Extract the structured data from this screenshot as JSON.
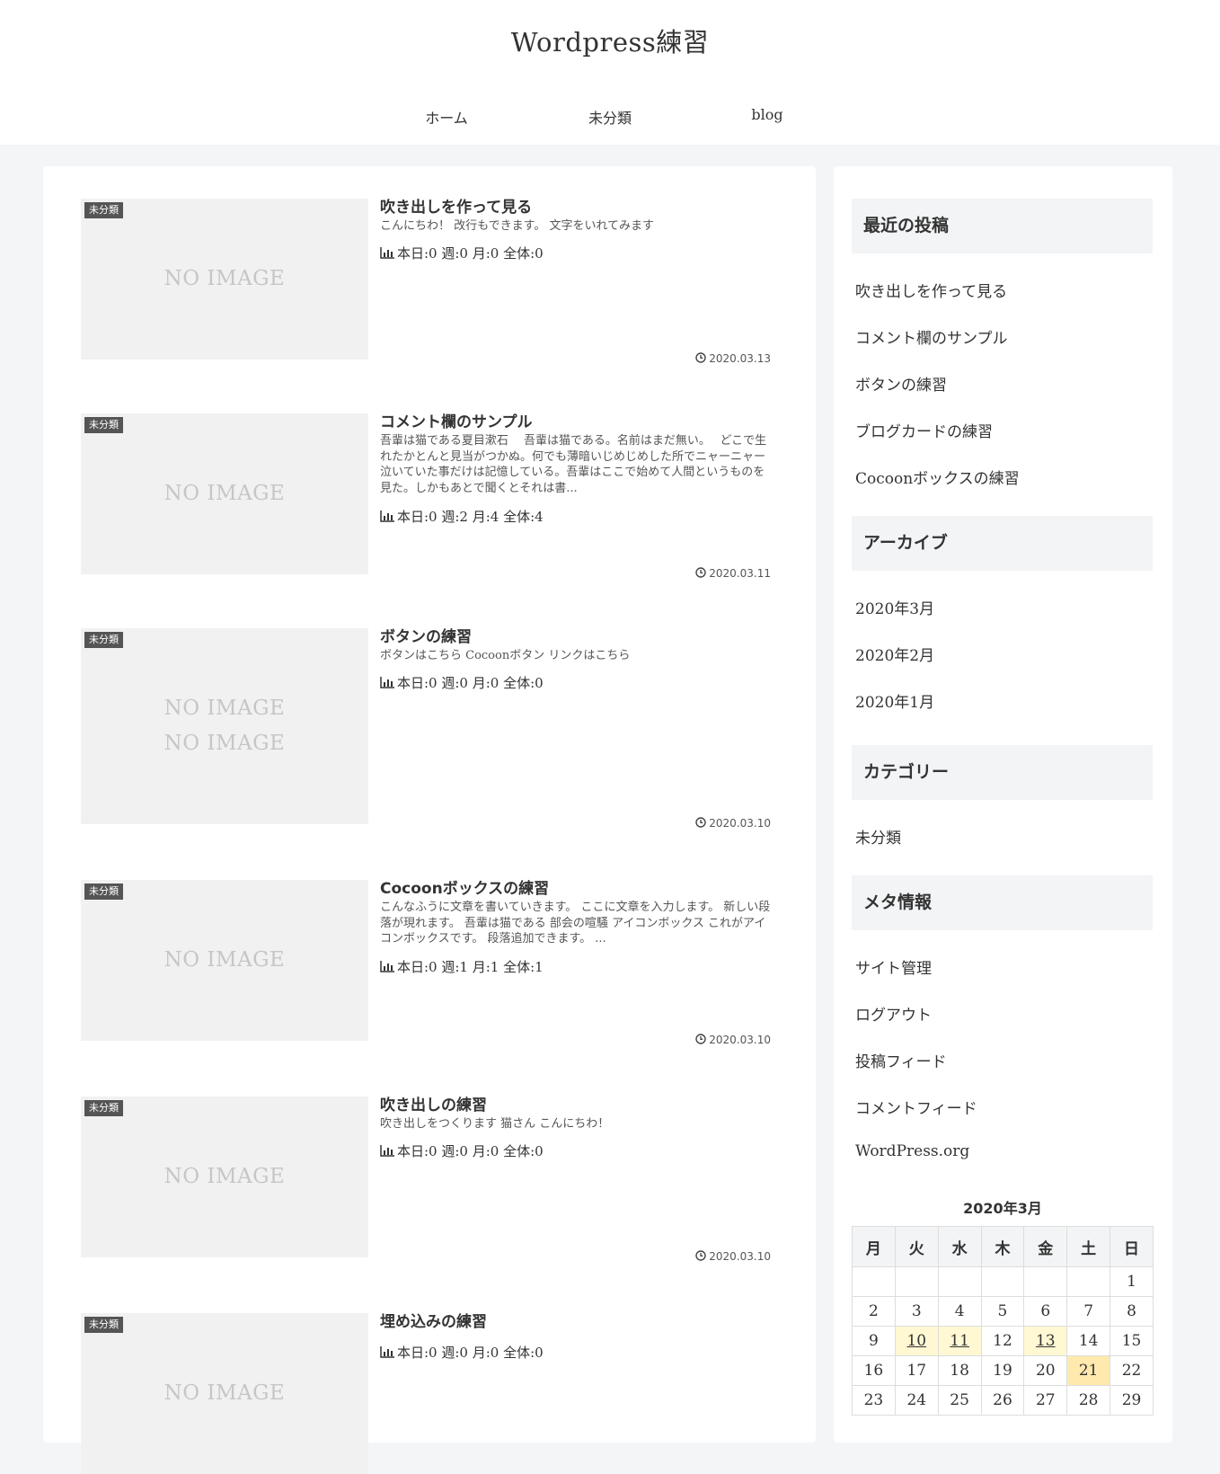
{
  "site": {
    "title": "Wordpress練習"
  },
  "nav": {
    "items": [
      "ホーム",
      "未分類",
      "blog"
    ]
  },
  "posts": [
    {
      "category": "未分類",
      "thumb_text": [
        "NO IMAGE"
      ],
      "title": "吹き出しを作って見る",
      "snippet": "こんにちわ！ 改行もできます。 文字をいれてみます",
      "views": "本日:0 週:0 月:0 全体:0",
      "date": "2020.03.13"
    },
    {
      "category": "未分類",
      "thumb_text": [
        "NO IMAGE"
      ],
      "title": "コメント欄のサンプル",
      "snippet": "吾輩は猫である夏目漱石　 吾輩は猫である。名前はまだ無い。　 どこで生れたかとんと見当がつかぬ。何でも薄暗いじめじめした所でニャーニャー泣いていた事だけは記憶している。吾輩はここで始めて人間というものを見た。しかもあとで聞くとそれは書...",
      "views": "本日:0 週:2 月:4 全体:4",
      "date": "2020.03.11"
    },
    {
      "category": "未分類",
      "thumb_text": [
        "NO IMAGE",
        "NO IMAGE"
      ],
      "title": "ボタンの練習",
      "snippet": "ボタンはこちら Cocoonボタン リンクはこちら",
      "views": "本日:0 週:0 月:0 全体:0",
      "date": "2020.03.10"
    },
    {
      "category": "未分類",
      "thumb_text": [
        "NO IMAGE"
      ],
      "title": "Cocoonボックスの練習",
      "snippet": "こんなふうに文章を書いていきます。 ここに文章を入力します。 新しい段落が現れます。 吾輩は猫である 部会の喧騒 アイコンボックス これがアイコンボックスです。 段落追加できます。 ...",
      "views": "本日:0 週:1 月:1 全体:1",
      "date": "2020.03.10"
    },
    {
      "category": "未分類",
      "thumb_text": [
        "NO IMAGE"
      ],
      "title": "吹き出しの練習",
      "snippet": "吹き出しをつくります 猫さん こんにちわ！",
      "views": "本日:0 週:0 月:0 全体:0",
      "date": "2020.03.10"
    },
    {
      "category": "未分類",
      "thumb_text": [
        "NO IMAGE"
      ],
      "title": "埋め込みの練習",
      "snippet": "",
      "views": "本日:0 週:0 月:0 全体:0",
      "date": ""
    }
  ],
  "sidebar": {
    "recent_title": "最近の投稿",
    "recent": [
      "吹き出しを作って見る",
      "コメント欄のサンプル",
      "ボタンの練習",
      "ブログカードの練習",
      "Cocoonボックスの練習"
    ],
    "archive_title": "アーカイブ",
    "archives": [
      "2020年3月",
      "2020年2月",
      "2020年1月"
    ],
    "category_title": "カテゴリー",
    "categories": [
      "未分類"
    ],
    "meta_title": "メタ情報",
    "meta": [
      "サイト管理",
      "ログアウト",
      "投稿フィード",
      "コメントフィード",
      "WordPress.org"
    ]
  },
  "calendar": {
    "caption": "2020年3月",
    "weekdays": [
      "月",
      "火",
      "水",
      "木",
      "金",
      "土",
      "日"
    ],
    "weeks": [
      [
        "",
        "",
        "",
        "",
        "",
        "",
        "1"
      ],
      [
        "2",
        "3",
        "4",
        "5",
        "6",
        "7",
        "8"
      ],
      [
        "9",
        "10",
        "11",
        "12",
        "13",
        "14",
        "15"
      ],
      [
        "16",
        "17",
        "18",
        "19",
        "20",
        "21",
        "22"
      ],
      [
        "23",
        "24",
        "25",
        "26",
        "27",
        "28",
        "29"
      ]
    ],
    "post_days": [
      "10",
      "11",
      "13"
    ],
    "today": "21"
  }
}
